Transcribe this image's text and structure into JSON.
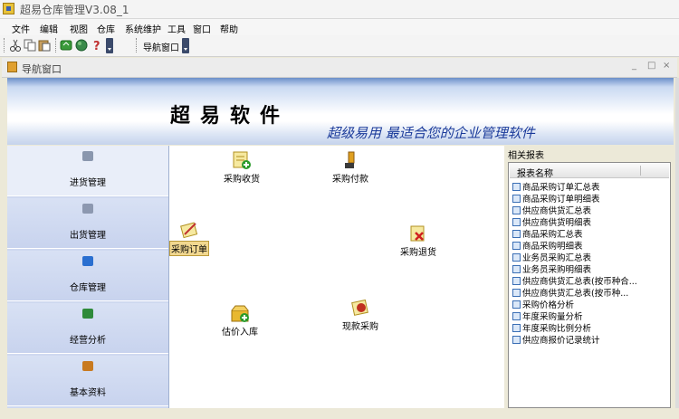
{
  "window": {
    "title": "超易仓库管理V3.08_1"
  },
  "menu": [
    "文件",
    "编辑",
    "视图",
    "仓库",
    "系统维护",
    "工具",
    "窗口",
    "帮助"
  ],
  "toolbar": {
    "icons": [
      "cut-icon",
      "copy-icon",
      "paste-icon",
      "refresh-icon",
      "globe-icon",
      "help-icon"
    ],
    "nav_window_label": "导航窗口"
  },
  "child_window": {
    "title": "导航窗口",
    "controls": [
      "_",
      "□",
      "×"
    ]
  },
  "banner": {
    "title": "超易软件",
    "slogan": "超级易用 最适合您的企业管理软件"
  },
  "left_nav": [
    {
      "label": "进货管理",
      "active": true,
      "icon": "purchase-icon",
      "color": "#7a8aa0"
    },
    {
      "label": "出货管理",
      "active": false,
      "icon": "shipping-icon",
      "color": "#8090a8"
    },
    {
      "label": "仓库管理",
      "active": false,
      "icon": "warehouse-icon",
      "color": "#2a6fd0"
    },
    {
      "label": "经营分析",
      "active": false,
      "icon": "analysis-icon",
      "color": "#2e8a3a"
    },
    {
      "label": "基本资料",
      "active": false,
      "icon": "basic-data-icon",
      "color": "#c87a20"
    }
  ],
  "tasks": [
    {
      "label": "采购收货",
      "icon": "receive-goods-icon"
    },
    {
      "label": "采购付款",
      "icon": "payment-icon"
    },
    {
      "label": "采购订单",
      "icon": "purchase-order-icon",
      "selected": true
    },
    {
      "label": "采购退货",
      "icon": "return-goods-icon"
    },
    {
      "label": "估价入库",
      "icon": "estimate-stock-in-icon"
    },
    {
      "label": "现款采购",
      "icon": "cash-purchase-icon"
    }
  ],
  "reports": {
    "title": "相关报表",
    "column_header": "报表名称",
    "items": [
      "商品采购订单汇总表",
      "商品采购订单明细表",
      "供应商供货汇总表",
      "供应商供货明细表",
      "商品采购汇总表",
      "商品采购明细表",
      "业务员采购汇总表",
      "业务员采购明细表",
      "供应商供货汇总表(按币种合...",
      "供应商供货汇总表(按币种...",
      "采购价格分析",
      "年度采购量分析",
      "年度采购比例分析",
      "供应商报价记录统计"
    ]
  }
}
